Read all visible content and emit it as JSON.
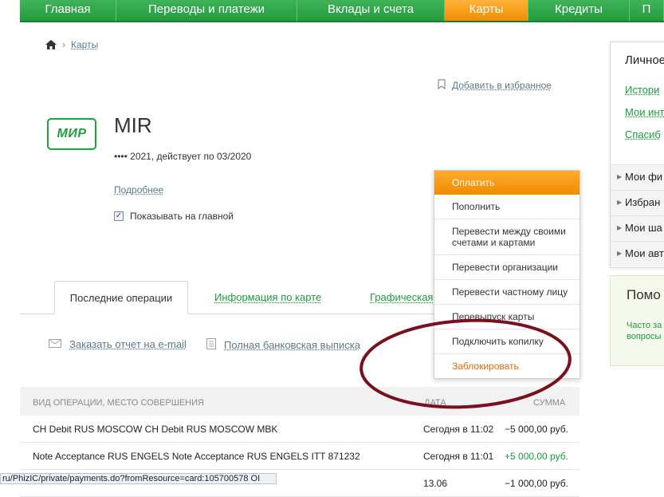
{
  "nav": {
    "items": [
      {
        "label": "Главная"
      },
      {
        "label": "Переводы и платежи"
      },
      {
        "label": "Вклады и счета"
      },
      {
        "label": "Карты",
        "active": true
      },
      {
        "label": "Кредиты"
      },
      {
        "label": "П"
      }
    ]
  },
  "breadcrumb": {
    "current": "Карты"
  },
  "favorite": {
    "label": "Добавить в избранное"
  },
  "card": {
    "logo_text": "МИР",
    "title": "MIR",
    "subtitle": "•••• 2021, действует по 03/2020",
    "more_link": "Подробнее",
    "show_on_main_label": "Показывать на главной",
    "show_on_main_checked": true
  },
  "tabs": {
    "last_ops": "Последние операции",
    "card_info": "Информация по карте",
    "graph": "Графическая"
  },
  "actions": {
    "email_report": "Заказать отчет на e-mail",
    "full_statement": "Полная банковская выписка"
  },
  "table": {
    "headers": {
      "op": "ВИД ОПЕРАЦИИ, МЕСТО СОВЕРШЕНИЯ",
      "date": "ДАТА",
      "amount": "СУММА"
    },
    "rows": [
      {
        "op": "CH Debit RUS MOSCOW CH Debit RUS MOSCOW MBK",
        "date": "Сегодня в 11:02",
        "amount": "−5 000,00 руб.",
        "positive": false
      },
      {
        "op": "Note Acceptance RUS ENGELS Note Acceptance RUS ENGELS ITT 871232",
        "date": "Сегодня в 11:01",
        "amount": "+5 000,00 руб.",
        "positive": true
      },
      {
        "op": "",
        "date": "13.06",
        "amount": "−1 000,00 руб.",
        "positive": false
      }
    ]
  },
  "menu": {
    "pay": "Оплатить",
    "items": [
      "Пополнить",
      "Перевести между своими счетами и картами",
      "Перевести организации",
      "Перевести частному лицу",
      "Перевыпуск карты",
      "Подключить копилку"
    ],
    "block": "Заблокировать"
  },
  "right": {
    "personal_head": "Личное",
    "links": [
      "Истори",
      "Мои инт",
      "Спасиб"
    ],
    "sections": [
      "Мои фи",
      "Избран",
      "Мои ша",
      "Мои авт"
    ],
    "help_head": "Помо",
    "help_text": [
      "Часто за",
      "вопросы"
    ]
  },
  "statusbar": {
    "text": "ru/PhizIC/private/payments.do?fromResource=card:105700578 OI"
  },
  "colors": {
    "brand_green": "#1a9c3f",
    "accent_orange": "#f18a00",
    "annotation_red": "#7a0f1e"
  }
}
